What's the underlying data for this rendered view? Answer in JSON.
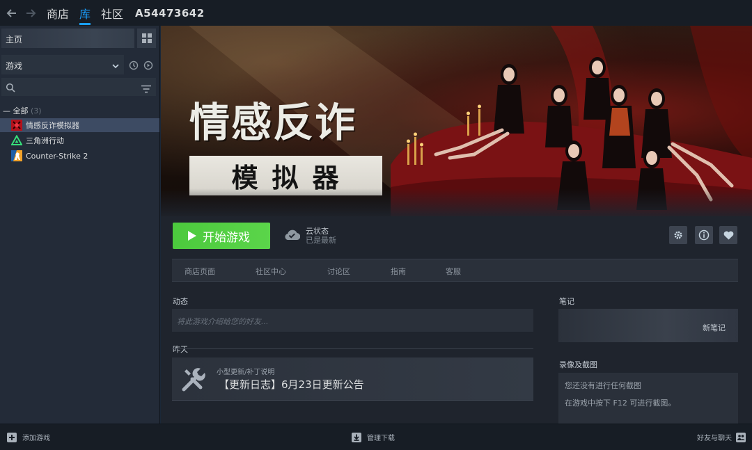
{
  "topbar": {
    "nav": [
      "商店",
      "库",
      "社区"
    ],
    "active_index": 1,
    "username": "A54473642"
  },
  "sidebar": {
    "home_label": "主页",
    "filter_label": "游戏",
    "group": {
      "label": "全部",
      "count": "(3)"
    },
    "games": [
      {
        "name": "情感反诈模拟器",
        "icon": "game-red-icon",
        "selected": true
      },
      {
        "name": "三角洲行动",
        "icon": "delta-icon",
        "selected": false
      },
      {
        "name": "Counter-Strike 2",
        "icon": "cs2-icon",
        "selected": false
      }
    ]
  },
  "hero": {
    "title_line1": "情感反诈",
    "title_line2": "模拟器"
  },
  "actions": {
    "play_label": "开始游戏",
    "cloud_title": "云状态",
    "cloud_status": "已是最新",
    "icons": [
      "gear-icon",
      "info-icon",
      "heart-icon"
    ]
  },
  "subnav": [
    "商店页面",
    "社区中心",
    "讨论区",
    "指南",
    "客服"
  ],
  "activity": {
    "label": "动态",
    "placeholder": "将此游戏介绍给您的好友...",
    "yesterday_label": "昨天",
    "news": {
      "type": "小型更新/补丁说明",
      "title": "【更新日志】6月23日更新公告"
    }
  },
  "notes": {
    "label": "笔记",
    "new_note": "新笔记"
  },
  "screenshots": {
    "label": "录像及截图",
    "line1": "您还没有进行任何截图",
    "line2": "在游戏中按下 F12 可进行截图。"
  },
  "bottombar": {
    "add_game": "添加游戏",
    "manage_downloads": "管理下载",
    "friends_chat": "好友与聊天"
  },
  "colors": {
    "accent": "#1a9fff",
    "play_green": "#5bd54a",
    "background": "#1b2838"
  }
}
